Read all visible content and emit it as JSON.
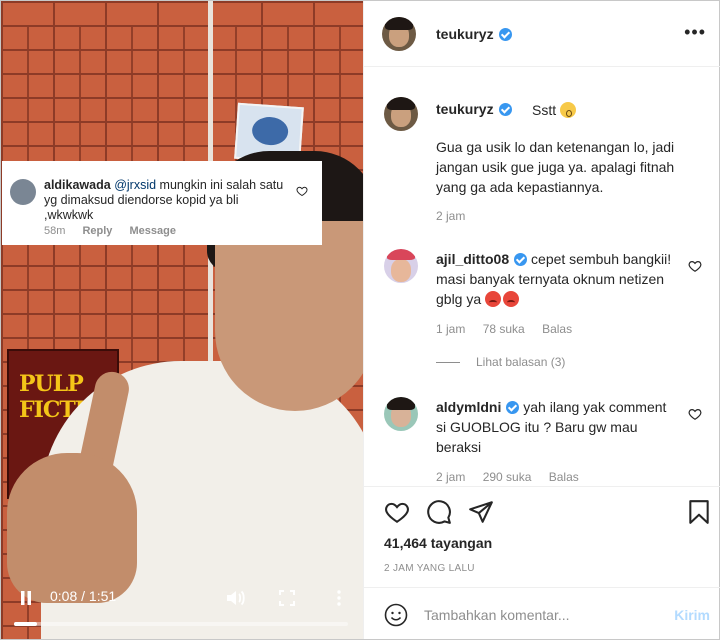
{
  "video": {
    "overlay_comment": {
      "username": "aldikawada",
      "mention": "@jrxsid",
      "text": "mungkin ini salah satu  yg dimaksud diendorse kopid ya bli ,wkwkwk",
      "time": "58m",
      "reply_label": "Reply",
      "message_label": "Message"
    },
    "poster_text": "PULP FICTI",
    "player": {
      "current_time": "0:08",
      "separator": " / ",
      "duration": "1:51",
      "progress_fraction": 0.07
    }
  },
  "header": {
    "username": "teukuryz",
    "verified": true,
    "more_icon": "more-horizontal-icon"
  },
  "caption": {
    "username": "teukuryz",
    "first_line": "Sstt",
    "body": "Gua ga usik lo dan ketenangan lo, jadi jangan usik gue juga ya. apalagi fitnah yang ga ada kepastiannya.",
    "time": "2 jam"
  },
  "comments": [
    {
      "username": "ajil_ditto08",
      "text": "cepet sembuh bangkii! masi banyak ternyata oknum netizen gblg ya",
      "time": "1 jam",
      "likes": "78 suka",
      "reply_label": "Balas"
    },
    {
      "username": "aldymldni",
      "text": "yah ilang yak comment si GUOBLOG itu ? Baru gw mau beraksi",
      "time": "2 jam",
      "likes": "290 suka",
      "reply_label": "Balas"
    }
  ],
  "view_replies": "Lihat balasan (3)",
  "actions": {
    "views": "41,464 tayangan",
    "posted_ago": "2 JAM YANG LALU"
  },
  "add_comment": {
    "placeholder": "Tambahkan komentar...",
    "post_label": "Kirim"
  },
  "colors": {
    "verified": "#3897f0",
    "link": "#00376b",
    "muted": "#8e8e8e",
    "post_disabled": "#b3dbff"
  }
}
